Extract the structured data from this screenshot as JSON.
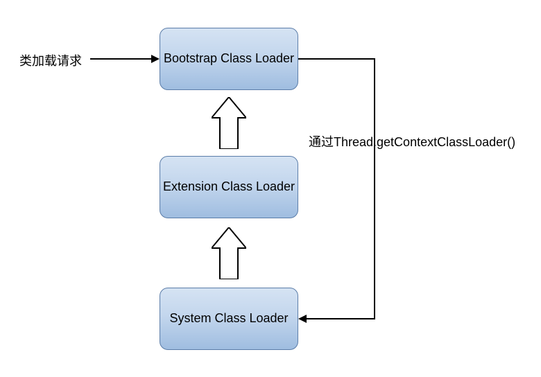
{
  "chart_data": {
    "type": "diagram",
    "title": "",
    "nodes": [
      {
        "id": "bootstrap",
        "label": "Bootstrap Class Loader"
      },
      {
        "id": "extension",
        "label": "Extension Class Loader"
      },
      {
        "id": "system",
        "label": "System Class Loader"
      }
    ],
    "edges": [
      {
        "from": "extension",
        "to": "bootstrap",
        "style": "hollow-up"
      },
      {
        "from": "system",
        "to": "extension",
        "style": "hollow-up"
      },
      {
        "from": "bootstrap",
        "to": "system",
        "style": "thin-arrow",
        "label": "通过Thread.getContextClassLoader()"
      },
      {
        "from": "external",
        "to": "bootstrap",
        "style": "thin-arrow",
        "label": "类加载请求"
      }
    ]
  },
  "boxes": {
    "bootstrap": "Bootstrap Class Loader",
    "extension": "Extension Class Loader",
    "system": "System Class Loader"
  },
  "labels": {
    "request": "类加载请求",
    "context": "通过Thread.getContextClassLoader()"
  }
}
